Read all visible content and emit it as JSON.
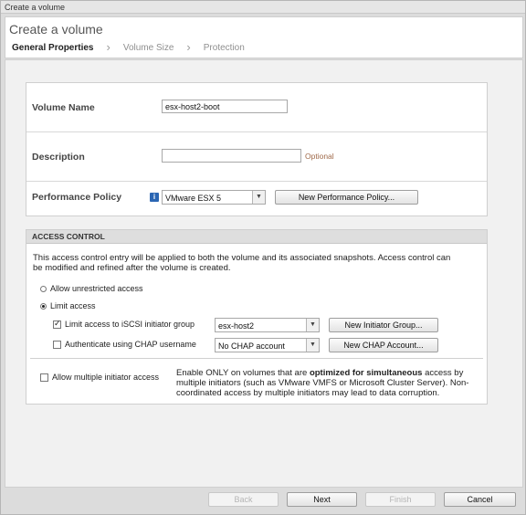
{
  "window": {
    "title": "Create a volume"
  },
  "header": {
    "title": "Create a volume",
    "steps": [
      "General Properties",
      "Volume Size",
      "Protection"
    ]
  },
  "general": {
    "volume_name_label": "Volume Name",
    "volume_name_value": "esx-host2-boot",
    "description_label": "Description",
    "description_value": "",
    "description_hint": "Optional",
    "performance_label": "Performance Policy",
    "info_icon": "info-icon",
    "performance_value": "VMware ESX 5",
    "new_policy_button": "New Performance Policy..."
  },
  "access_control": {
    "heading": "ACCESS CONTROL",
    "description": "This access control entry will be applied to both the volume and its associated snapshots. Access control can be modified and refined after the volume is created.",
    "allow_unrestricted_label": "Allow unrestricted access",
    "allow_unrestricted_selected": false,
    "limit_access_label": "Limit access",
    "limit_access_selected": true,
    "iscsi_label": "Limit access to iSCSI initiator group",
    "iscsi_checked": true,
    "iscsi_value": "esx-host2",
    "new_initiator_button": "New Initiator Group...",
    "chap_label": "Authenticate using CHAP username",
    "chap_checked": false,
    "chap_value": "No CHAP account",
    "new_chap_button": "New CHAP Account...",
    "multi_initiator_label": "Allow multiple initiator access",
    "multi_initiator_checked": false,
    "multi_text_1": "Enable ONLY on volumes that are ",
    "multi_text_bold": "optimized for simultaneous",
    "multi_text_2": " access by multiple initiators (such as VMware VMFS or Microsoft Cluster Server). Non-coordinated access by multiple initiators may lead to data corruption."
  },
  "footer": {
    "back": "Back",
    "next": "Next",
    "finish": "Finish",
    "cancel": "Cancel"
  }
}
